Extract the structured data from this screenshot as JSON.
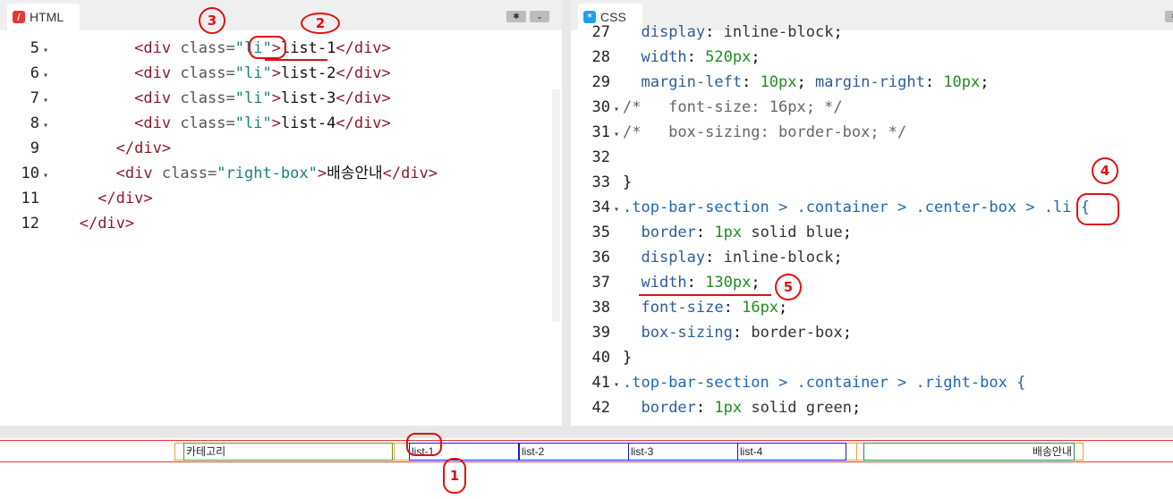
{
  "html_tab": {
    "label": "HTML",
    "icon": "html-file-icon"
  },
  "css_tab": {
    "label": "CSS",
    "icon": "css-file-icon"
  },
  "buttons": {
    "settings": "✱",
    "dropdown": "⌄"
  },
  "html_lines": [
    {
      "n": "5",
      "fold": true,
      "indent": "      ",
      "tag1": "<div ",
      "attr": "class=",
      "str": "\"li\"",
      "close": ">",
      "text": "list-1",
      "end": "</div>"
    },
    {
      "n": "6",
      "fold": true,
      "indent": "      ",
      "tag1": "<div ",
      "attr": "class=",
      "str": "\"li\"",
      "close": ">",
      "text": "list-2",
      "end": "</div>"
    },
    {
      "n": "7",
      "fold": true,
      "indent": "      ",
      "tag1": "<div ",
      "attr": "class=",
      "str": "\"li\"",
      "close": ">",
      "text": "list-3",
      "end": "</div>"
    },
    {
      "n": "8",
      "fold": true,
      "indent": "      ",
      "tag1": "<div ",
      "attr": "class=",
      "str": "\"li\"",
      "close": ">",
      "text": "list-4",
      "end": "</div>"
    },
    {
      "n": "9",
      "fold": false,
      "indent": "    ",
      "tag1": "</div>",
      "attr": "",
      "str": "",
      "close": "",
      "text": "",
      "end": ""
    },
    {
      "n": "10",
      "fold": true,
      "indent": "    ",
      "tag1": "<div ",
      "attr": "class=",
      "str": "\"right-box\"",
      "close": ">",
      "text": "배송안내",
      "end": "</div>"
    },
    {
      "n": "11",
      "fold": false,
      "indent": "  ",
      "tag1": "</div>",
      "attr": "",
      "str": "",
      "close": "",
      "text": "",
      "end": ""
    },
    {
      "n": "12",
      "fold": false,
      "indent": "",
      "tag1": "</div>",
      "attr": "",
      "str": "",
      "close": "",
      "text": "",
      "end": ""
    }
  ],
  "css_lines": [
    {
      "n": "27",
      "fold": false,
      "kind": "decl",
      "prop": "display",
      "val": "inline-block",
      "valClass": "vv"
    },
    {
      "n": "28",
      "fold": false,
      "kind": "decl",
      "prop": "width",
      "val": "520px",
      "valClass": "v"
    },
    {
      "n": "29",
      "fold": false,
      "kind": "decl2",
      "prop": "margin-left",
      "val": "10px",
      "prop2": "margin-right",
      "val2": "10px"
    },
    {
      "n": "30",
      "fold": true,
      "kind": "comment",
      "text": "/*   font-size: 16px; */"
    },
    {
      "n": "31",
      "fold": true,
      "kind": "comment",
      "text": "/*   box-sizing: border-box; */"
    },
    {
      "n": "32",
      "fold": false,
      "kind": "blank"
    },
    {
      "n": "33",
      "fold": false,
      "kind": "brace",
      "text": "}"
    },
    {
      "n": "34",
      "fold": true,
      "kind": "selector",
      "text": ".top-bar-section > .container > .center-box > .li {"
    },
    {
      "n": "35",
      "fold": false,
      "kind": "decl",
      "prop": "border",
      "val": "1px solid blue",
      "valClass": "vv",
      "num": "1px"
    },
    {
      "n": "36",
      "fold": false,
      "kind": "decl",
      "prop": "display",
      "val": "inline-block",
      "valClass": "vv"
    },
    {
      "n": "37",
      "fold": false,
      "kind": "decl",
      "prop": "width",
      "val": "130px",
      "valClass": "v"
    },
    {
      "n": "38",
      "fold": false,
      "kind": "decl",
      "prop": "font-size",
      "val": "16px",
      "valClass": "v"
    },
    {
      "n": "39",
      "fold": false,
      "kind": "decl",
      "prop": "box-sizing",
      "val": "border-box",
      "valClass": "vv"
    },
    {
      "n": "40",
      "fold": false,
      "kind": "brace",
      "text": "}"
    },
    {
      "n": "41",
      "fold": true,
      "kind": "selector",
      "text": ".top-bar-section > .container > .right-box {"
    },
    {
      "n": "42",
      "fold": false,
      "kind": "decl",
      "prop": "border",
      "val": "1px solid green",
      "valClass": "vv",
      "num": "1px"
    }
  ],
  "preview": {
    "left_box": "카테고리",
    "items": [
      "list-1",
      "list-2",
      "list-3",
      "list-4"
    ],
    "right_box": "배송안내"
  },
  "annotations": [
    "1",
    "2",
    "3",
    "4",
    "5"
  ],
  "colors": {
    "annotation": "#e01010",
    "list_border": "#1a1ad6",
    "left_border": "#6b8e23",
    "right_border": "#2e8b57",
    "outer_border": "#f0a030"
  }
}
